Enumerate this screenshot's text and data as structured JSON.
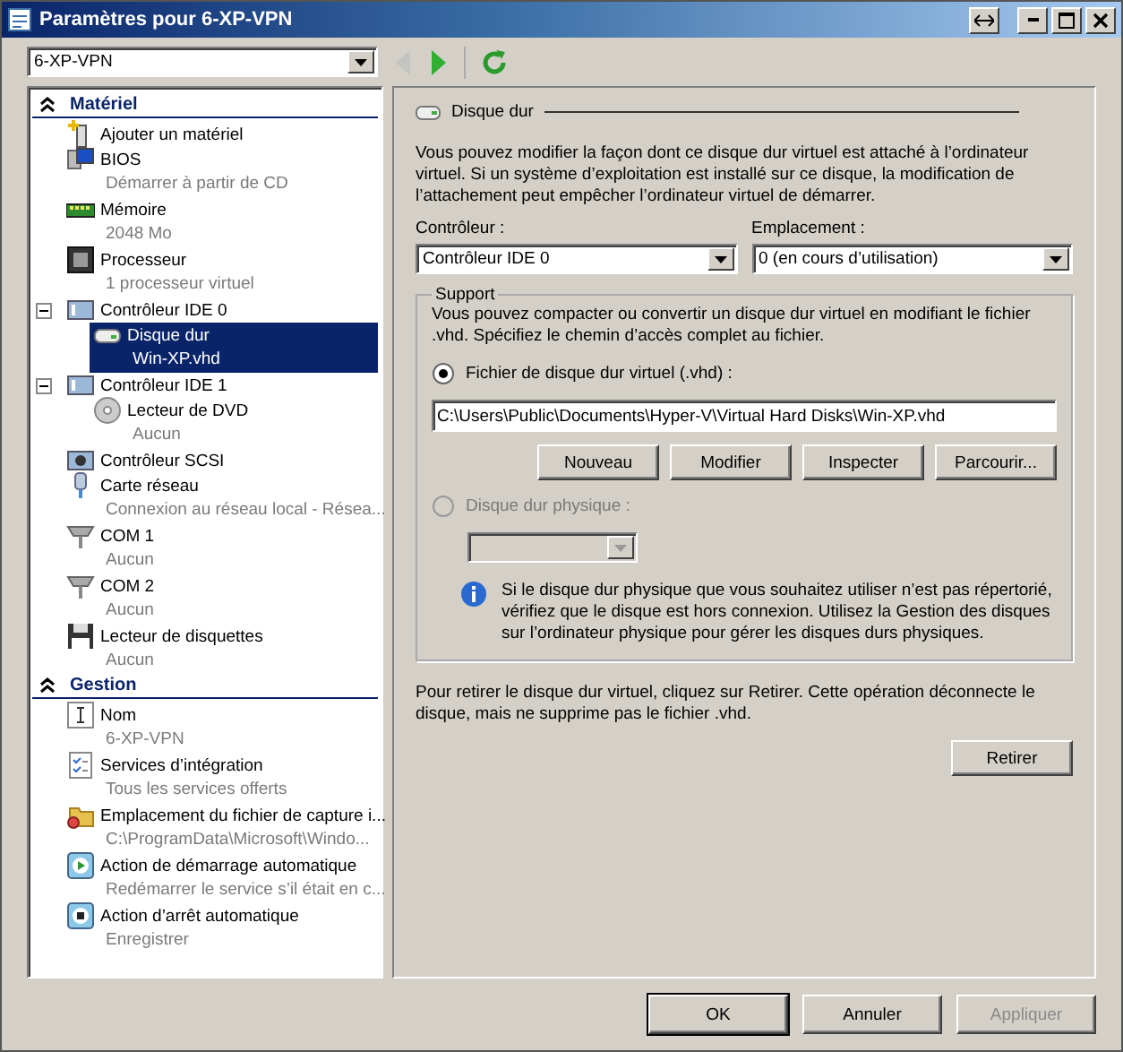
{
  "window": {
    "title": "Paramètres pour 6-XP-VPN"
  },
  "toolbar": {
    "vm": "6-XP-VPN",
    "back_enabled": false,
    "forward_enabled": true
  },
  "sidebar": {
    "sections": [
      {
        "title": "Matériel",
        "expanded": true,
        "items": [
          {
            "label": "Ajouter un matériel",
            "kind": "add",
            "selected": false
          },
          {
            "label": "BIOS",
            "detail": "Démarrer à partir de CD",
            "kind": "bios",
            "selected": false
          },
          {
            "label": "Mémoire",
            "detail": "2048 Mo",
            "kind": "memory",
            "selected": false
          },
          {
            "label": "Processeur",
            "detail": "1 processeur virtuel",
            "kind": "cpu",
            "selected": false
          },
          {
            "label": "Contrôleur IDE 0",
            "kind": "controller",
            "selected": false,
            "expanded": true,
            "children": [
              {
                "label": "Disque dur",
                "detail": "Win-XP.vhd",
                "kind": "disk",
                "selected": true
              }
            ]
          },
          {
            "label": "Contrôleur IDE 1",
            "kind": "controller",
            "selected": false,
            "expanded": true,
            "children": [
              {
                "label": "Lecteur de DVD",
                "detail": "Aucun",
                "kind": "dvd",
                "selected": false
              }
            ]
          },
          {
            "label": "Contrôleur SCSI",
            "kind": "scsi",
            "selected": false
          },
          {
            "label": "Carte réseau",
            "detail": "Connexion au réseau local - Résea...",
            "kind": "network",
            "selected": false
          },
          {
            "label": "COM 1",
            "detail": "Aucun",
            "kind": "com",
            "selected": false
          },
          {
            "label": "COM 2",
            "detail": "Aucun",
            "kind": "com",
            "selected": false
          },
          {
            "label": "Lecteur de disquettes",
            "detail": "Aucun",
            "kind": "floppy",
            "selected": false
          }
        ]
      },
      {
        "title": "Gestion",
        "expanded": true,
        "items": [
          {
            "label": "Nom",
            "detail": "6-XP-VPN",
            "kind": "name",
            "selected": false
          },
          {
            "label": "Services d’intégration",
            "detail": "Tous les services offerts",
            "kind": "services",
            "selected": false
          },
          {
            "label": "Emplacement du fichier de capture i...",
            "detail": "C:\\ProgramData\\Microsoft\\Windo...",
            "kind": "folder",
            "selected": false
          },
          {
            "label": "Action de démarrage automatique",
            "detail": "Redémarrer le service s’il était en c...",
            "kind": "start",
            "selected": false
          },
          {
            "label": "Action d’arrêt automatique",
            "detail": "Enregistrer",
            "kind": "stop",
            "selected": false
          }
        ]
      }
    ]
  },
  "panel": {
    "title": "Disque dur",
    "description": "Vous pouvez modifier la façon dont ce disque dur virtuel est attaché à l’ordinateur virtuel. Si un système d’exploitation est installé sur ce disque, la modification de l’attachement peut empêcher l’ordinateur virtuel de démarrer.",
    "controller": {
      "label": "Contrôleur :",
      "value": "Contrôleur IDE 0"
    },
    "location": {
      "label": "Emplacement :",
      "value": "0 (en cours d’utilisation)"
    },
    "media": {
      "title": "Support",
      "description": "Vous pouvez compacter ou convertir un disque dur virtuel en modifiant le fichier .vhd. Spécifiez le chemin d’accès complet au fichier.",
      "options": [
        {
          "label": "Fichier de disque dur virtuel (.vhd) :",
          "selected": true,
          "disabled": false
        },
        {
          "label": "Disque dur physique :",
          "selected": false,
          "disabled": true
        }
      ],
      "path": "C:\\Users\\Public\\Documents\\Hyper-V\\Virtual Hard Disks\\Win-XP.vhd",
      "buttons": [
        "Nouveau",
        "Modifier",
        "Inspecter",
        "Parcourir..."
      ],
      "info": "Si le disque dur physique que vous souhaitez utiliser n’est pas répertorié, vérifiez que le disque est hors connexion. Utilisez la Gestion des disques sur l’ordinateur physique pour gérer les disques durs physiques."
    },
    "remove_note": "Pour retirer le disque dur virtuel, cliquez sur Retirer. Cette opération déconnecte le disque, mais ne supprime pas le fichier .vhd.",
    "remove_button": "Retirer"
  },
  "footer": {
    "buttons": [
      {
        "label": "OK",
        "default": true,
        "disabled": false
      },
      {
        "label": "Annuler",
        "default": false,
        "disabled": false
      },
      {
        "label": "Appliquer",
        "default": false,
        "disabled": true
      }
    ]
  }
}
